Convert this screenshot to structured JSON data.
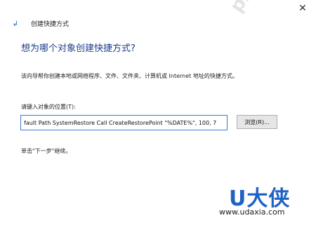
{
  "window": {
    "title": "创建快捷方式",
    "app_icon": "shortcut-wizard-icon",
    "close_glyph": "✕"
  },
  "wizard": {
    "heading": "想为哪个对象创建快捷方式?",
    "description": "该向导帮你创建本地或网络程序、文件、文件夹、计算机或 Internet 地址的快捷方式。",
    "location_label": "请键入对象的位置(T):",
    "location_value": "fault Path SystemRestore Call CreateRestorePoint \"%DATE%\", 100, 7",
    "browse_label": "浏览(R)...",
    "hint": "单击\"下一步\"继续。"
  },
  "watermarks": {
    "php": "php",
    "logo": "U大侠",
    "url": "www.udaxia.com"
  },
  "colors": {
    "heading": "#1c3e8a",
    "input_border": "#3a78d6",
    "logo": "#1e62c4"
  }
}
